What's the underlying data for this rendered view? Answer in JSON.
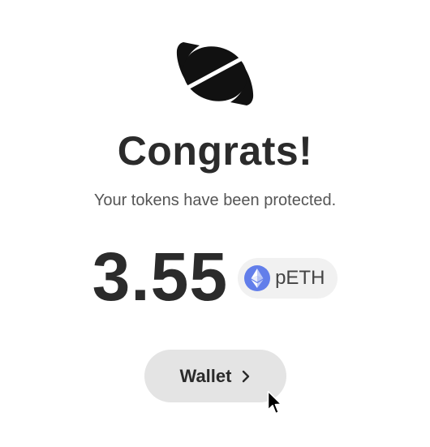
{
  "logo": {
    "icon": "wrapped-candy-logo-icon"
  },
  "title": "Congrats!",
  "subtitle": "Your tokens have been protected.",
  "balance": {
    "amount": "3.55",
    "token": "pETH",
    "token_icon": "ethereum-icon",
    "token_icon_color": "#627eea"
  },
  "wallet_button": {
    "label": "Wallet",
    "icon": "chevron-right-icon"
  },
  "colors": {
    "text_primary": "#2b2b2b",
    "text_secondary": "#555555",
    "button_bg": "#e4e4e4",
    "pill_bg": "#f1f1f1"
  }
}
